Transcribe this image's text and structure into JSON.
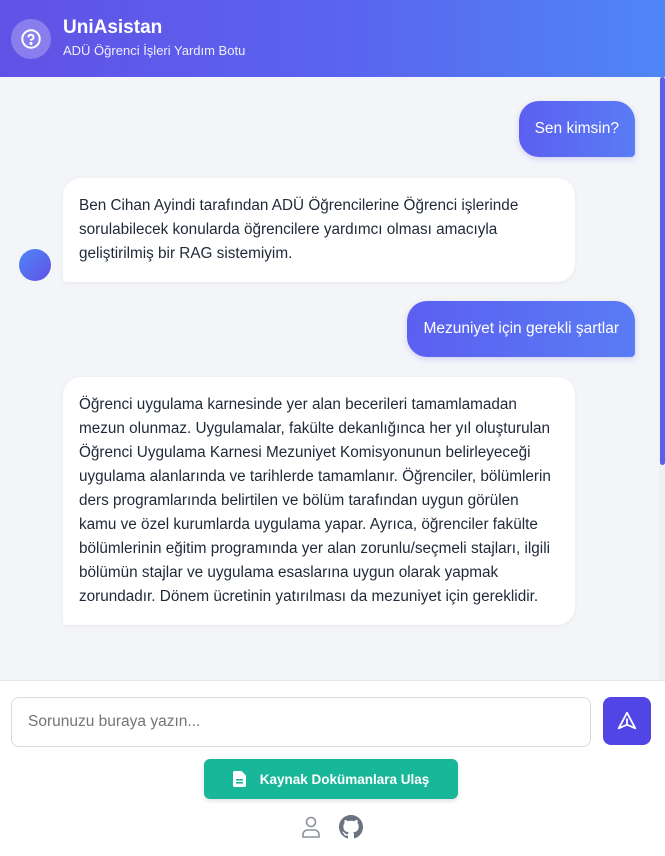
{
  "header": {
    "title": "UniAsistan",
    "subtitle": "ADÜ Öğrenci İşleri Yardım Botu",
    "icon": "help-circle-icon"
  },
  "messages": [
    {
      "role": "user",
      "text": "Sen kimsin?"
    },
    {
      "role": "bot",
      "text": "Ben Cihan Ayindi tarafından ADÜ Öğrencilerine Öğrenci işlerinde sorulabilecek konularda öğrencilere yardımcı olması amacıyla geliştirilmiş bir RAG sistemiyim."
    },
    {
      "role": "user",
      "text": "Mezuniyet için gerekli şartlar"
    },
    {
      "role": "bot",
      "text": "Öğrenci uygulama karnesinde yer alan becerileri tamamlamadan mezun olunmaz. Uygulamalar, fakülte dekanlığınca her yıl oluşturulan Öğrenci Uygulama Karnesi Mezuniyet Komisyonunun belirleyeceği uygulama alanlarında ve tarihlerde tamamlanır. Öğrenciler, bölümlerin ders programlarında belirtilen ve bölüm tarafından uygun görülen kamu ve özel kurumlarda uygulama yapar. Ayrıca, öğrenciler fakülte bölümlerinin eğitim programında yer alan zorunlu/seçmeli stajları, ilgili bölümün stajlar ve uygulama esaslarına uygun olarak yapmak zorundadır. Dönem ücretinin yatırılması da mezuniyet için gereklidir."
    }
  ],
  "input": {
    "placeholder": "Sorunuzu buraya yazın...",
    "value": ""
  },
  "send_button": {
    "icon": "send-icon"
  },
  "docs_button": {
    "label": "Kaynak Dokümanlara Ulaş",
    "icon": "document-icon"
  },
  "footer_links": [
    {
      "icon": "user-icon"
    },
    {
      "icon": "github-icon"
    }
  ],
  "colors": {
    "header_gradient_start": "#6152e6",
    "header_gradient_end": "#4f86f7",
    "user_bubble": "#5b5ff0",
    "chat_background": "#f4f5f8",
    "send_button": "#5146e5",
    "docs_button": "#19b79a"
  }
}
